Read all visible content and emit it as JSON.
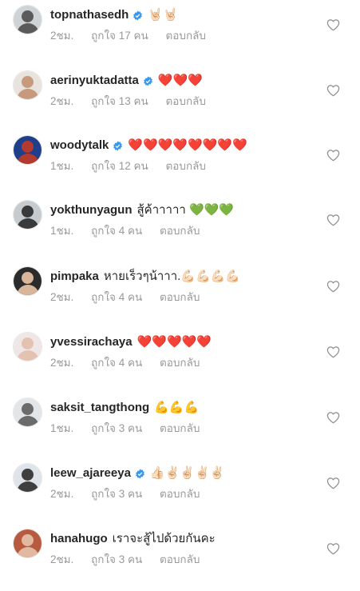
{
  "comments": [
    {
      "username": "topnathasedh",
      "verified": true,
      "text": "🤘🏻🤘🏻",
      "time": "2ชม.",
      "likes": "ถูกใจ 17 คน",
      "reply": "ตอบกลับ",
      "avatar_color": "#5a5a5a",
      "avatar_bg": "#cfd3d6"
    },
    {
      "username": "aerinyuktadatta",
      "verified": true,
      "text": "❤️❤️❤️",
      "time": "2ชม.",
      "likes": "ถูกใจ 13 คน",
      "reply": "ตอบกลับ",
      "avatar_color": "#c79a7e",
      "avatar_bg": "#e9e3de"
    },
    {
      "username": "woodytalk",
      "verified": true,
      "text": "❤️❤️❤️❤️❤️❤️❤️❤️",
      "time": "1ชม.",
      "likes": "ถูกใจ 12 คน",
      "reply": "ตอบกลับ",
      "avatar_color": "#b23a2e",
      "avatar_bg": "#1f3f8a"
    },
    {
      "username": "yokthunyagun",
      "verified": false,
      "text": "สู้ค้าาาาา 💚💚💚",
      "time": "1ชม.",
      "likes": "ถูกใจ 4 คน",
      "reply": "ตอบกลับ",
      "avatar_color": "#3a3a3a",
      "avatar_bg": "#c6cbd0"
    },
    {
      "username": "pimpaka",
      "verified": false,
      "text": "หายเร็วๆน้าาา.💪🏻💪🏻💪🏻💪🏻",
      "time": "2ชม.",
      "likes": "ถูกใจ 4 คน",
      "reply": "ตอบกลับ",
      "avatar_color": "#d9b59c",
      "avatar_bg": "#2b2b2b"
    },
    {
      "username": "yvessirachaya",
      "verified": false,
      "text": "❤️❤️❤️❤️❤️",
      "time": "2ชม.",
      "likes": "ถูกใจ 4 คน",
      "reply": "ตอบกลับ",
      "avatar_color": "#e4c2b2",
      "avatar_bg": "#f1e6e6"
    },
    {
      "username": "saksit_tangthong",
      "verified": false,
      "text": "💪💪💪",
      "time": "1ชม.",
      "likes": "ถูกใจ 3 คน",
      "reply": "ตอบกลับ",
      "avatar_color": "#6b6b6b",
      "avatar_bg": "#e3e6e8"
    },
    {
      "username": "leew_ajareeya",
      "verified": true,
      "text": "👍🏻✌🏻✌🏻✌🏻✌🏻",
      "time": "2ชม.",
      "likes": "ถูกใจ 3 คน",
      "reply": "ตอบกลับ",
      "avatar_color": "#3f3f3f",
      "avatar_bg": "#dfe4ea"
    },
    {
      "username": "hanahugo",
      "verified": false,
      "text": "เราจะสู้ไปด้วยกันคะ",
      "time": "2ชม.",
      "likes": "ถูกใจ 3 คน",
      "reply": "ตอบกลับ",
      "avatar_color": "#e0b9a0",
      "avatar_bg": "#b85a3f"
    }
  ],
  "colors": {
    "text": "#262626",
    "meta": "#999999",
    "verified": "#3897f0",
    "heart_outline": "#8e8e8e"
  }
}
